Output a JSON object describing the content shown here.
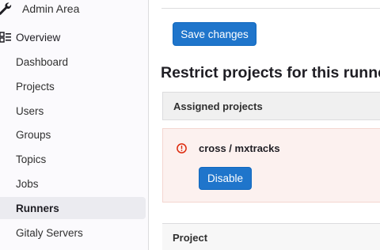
{
  "sidebar": {
    "header": {
      "title": "Admin Area",
      "icon": "wrench-icon"
    },
    "section": {
      "label": "Overview",
      "icon": "overview-icon"
    },
    "items": [
      {
        "label": "Dashboard"
      },
      {
        "label": "Projects"
      },
      {
        "label": "Users"
      },
      {
        "label": "Groups"
      },
      {
        "label": "Topics"
      },
      {
        "label": "Jobs"
      },
      {
        "label": "Runners",
        "active": true
      },
      {
        "label": "Gitaly Servers"
      }
    ]
  },
  "main": {
    "save_label": "Save changes",
    "heading": "Restrict projects for this runner",
    "assigned": {
      "header": "Assigned projects",
      "projects": [
        {
          "name": "cross / mxtracks",
          "status_icon": "error-icon",
          "action_label": "Disable"
        }
      ]
    },
    "table": {
      "column_header": "Project"
    }
  },
  "colors": {
    "primary": "#1f75cb",
    "error": "#dd2b0e",
    "error_bg": "#fcf1ef",
    "sidebar_bg": "#fbfafd",
    "active_bg": "#ebebf0"
  }
}
